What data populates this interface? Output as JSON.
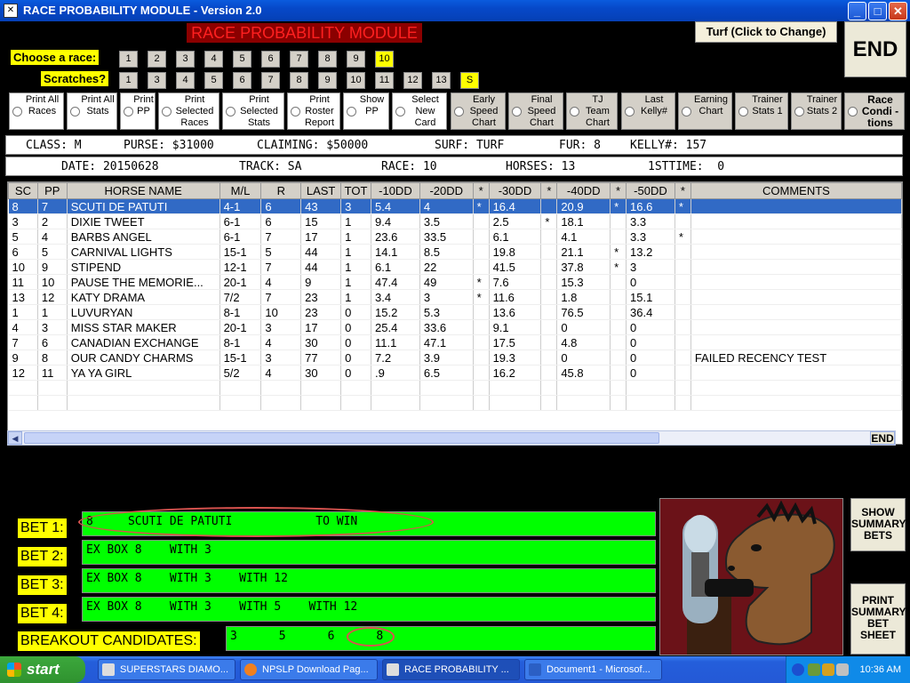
{
  "window": {
    "title": "RACE PROBABILITY MODULE - Version 2.0"
  },
  "header": {
    "module_title": "RACE PROBABILITY MODULE",
    "turf_button": "Turf (Click to Change)",
    "end_button": "END",
    "choose_label": "Choose  a race:",
    "scratches_label": "Scratches?"
  },
  "race_buttons": [
    "1",
    "2",
    "3",
    "4",
    "5",
    "6",
    "7",
    "8",
    "9",
    "10"
  ],
  "selected_race": "10",
  "scratch_buttons": [
    "1",
    "3",
    "4",
    "5",
    "6",
    "7",
    "8",
    "9",
    "10",
    "11",
    "12",
    "13",
    "S"
  ],
  "options": [
    {
      "label": "Print All Races"
    },
    {
      "label": "Print All Stats"
    },
    {
      "label": "Print PP"
    },
    {
      "label": "Print Selected Races"
    },
    {
      "label": "Print Selected Stats"
    },
    {
      "label": "Print Roster Report"
    },
    {
      "label": "Show PP"
    },
    {
      "label": "Select New Card"
    },
    {
      "label": "Early Speed Chart"
    },
    {
      "label": "Final Speed Chart"
    },
    {
      "label": "TJ Team Chart"
    },
    {
      "label": "Last Kelly#"
    },
    {
      "label": "Earning Chart"
    },
    {
      "label": "Trainer Stats 1"
    },
    {
      "label": "Trainer Stats 2"
    },
    {
      "label": "Race Condi -tions"
    }
  ],
  "race_info": {
    "class": "CLASS: M",
    "purse": "PURSE: $31000",
    "claiming": "CLAIMING: $50000",
    "surf": "SURF: TURF",
    "fur": "FUR: 8",
    "kelly": "KELLY#: 157",
    "date": "DATE: 20150628",
    "track": "TRACK: SA",
    "race": "RACE: 10",
    "horses": "HORSES: 13",
    "firsttime": "1STTIME:  0"
  },
  "table": {
    "columns": [
      "SC",
      "PP",
      "HORSE NAME",
      "M/L",
      "R",
      "LAST",
      "TOT",
      "-10DD",
      "-20DD",
      "*",
      "-30DD",
      "*",
      "-40DD",
      "*",
      "-50DD",
      "*",
      "COMMENTS"
    ],
    "rows": [
      [
        "8",
        "7",
        "SCUTI DE PATUTI",
        "4-1",
        "6",
        "43",
        "3",
        "5.4",
        "4",
        "*",
        "16.4",
        "",
        "20.9",
        "*",
        "16.6",
        "*",
        ""
      ],
      [
        "3",
        "2",
        "DIXIE TWEET",
        "6-1",
        "6",
        "15",
        "1",
        "9.4",
        "3.5",
        "",
        "2.5",
        "*",
        "18.1",
        "",
        "3.3",
        "",
        ""
      ],
      [
        "5",
        "4",
        "BARBS ANGEL",
        "6-1",
        "7",
        "17",
        "1",
        "23.6",
        "33.5",
        "",
        "6.1",
        "",
        "4.1",
        "",
        "3.3",
        "*",
        ""
      ],
      [
        "6",
        "5",
        "CARNIVAL LIGHTS",
        "15-1",
        "5",
        "44",
        "1",
        "14.1",
        "8.5",
        "",
        "19.8",
        "",
        "21.1",
        "*",
        "13.2",
        "",
        ""
      ],
      [
        "10",
        "9",
        "STIPEND",
        "12-1",
        "7",
        "44",
        "1",
        "6.1",
        "22",
        "",
        "41.5",
        "",
        "37.8",
        "*",
        "3",
        "",
        ""
      ],
      [
        "11",
        "10",
        "PAUSE THE MEMORIE...",
        "20-1",
        "4",
        "9",
        "1",
        "47.4",
        "49",
        "*",
        "7.6",
        "",
        "15.3",
        "",
        "0",
        "",
        ""
      ],
      [
        "13",
        "12",
        "KATY DRAMA",
        "7/2",
        "7",
        "23",
        "1",
        "3.4",
        "3",
        "*",
        "11.6",
        "",
        "1.8",
        "",
        "15.1",
        "",
        ""
      ],
      [
        "1",
        "1",
        "LUVURYAN",
        "8-1",
        "10",
        "23",
        "0",
        "15.2",
        "5.3",
        "",
        "13.6",
        "",
        "76.5",
        "",
        "36.4",
        "",
        ""
      ],
      [
        "4",
        "3",
        "MISS STAR MAKER",
        "20-1",
        "3",
        "17",
        "0",
        "25.4",
        "33.6",
        "",
        "9.1",
        "",
        "0",
        "",
        "0",
        "",
        ""
      ],
      [
        "7",
        "6",
        "CANADIAN EXCHANGE",
        "8-1",
        "4",
        "30",
        "0",
        "11.1",
        "47.1",
        "",
        "17.5",
        "",
        "4.8",
        "",
        "0",
        "",
        ""
      ],
      [
        "9",
        "8",
        "OUR CANDY CHARMS",
        "15-1",
        "3",
        "77",
        "0",
        "7.2",
        "3.9",
        "",
        "19.3",
        "",
        "0",
        "",
        "0",
        "",
        "FAILED RECENCY TEST"
      ],
      [
        "12",
        "11",
        "YA YA GIRL",
        "5/2",
        "4",
        "30",
        "0",
        ".9",
        "6.5",
        "",
        "16.2",
        "",
        "45.8",
        "",
        "0",
        "",
        ""
      ]
    ]
  },
  "scroll": {
    "right_arrow": "END"
  },
  "bets": [
    {
      "label": "BET 1:",
      "text": "8     SCUTI DE PATUTI            TO WIN"
    },
    {
      "label": "BET 2:",
      "text": "EX BOX 8    WITH 3"
    },
    {
      "label": "BET 3:",
      "text": "EX BOX 8    WITH 3    WITH 12"
    },
    {
      "label": "BET 4:",
      "text": "EX BOX 8    WITH 3    WITH 5    WITH 12"
    }
  ],
  "breakout": {
    "label": "BREAKOUT CANDIDATES:",
    "text": "3      5      6      8"
  },
  "side_buttons": {
    "show_summary": "SHOW SUMMARY BETS",
    "print_summary": "PRINT SUMMARY BET SHEET"
  },
  "taskbar": {
    "start": "start",
    "tasks": [
      {
        "label": "SUPERSTARS DIAMO..."
      },
      {
        "label": "NPSLP Download Pag..."
      },
      {
        "label": "RACE PROBABILITY ..."
      },
      {
        "label": "Document1 - Microsof..."
      }
    ],
    "clock": "10:36 AM"
  }
}
